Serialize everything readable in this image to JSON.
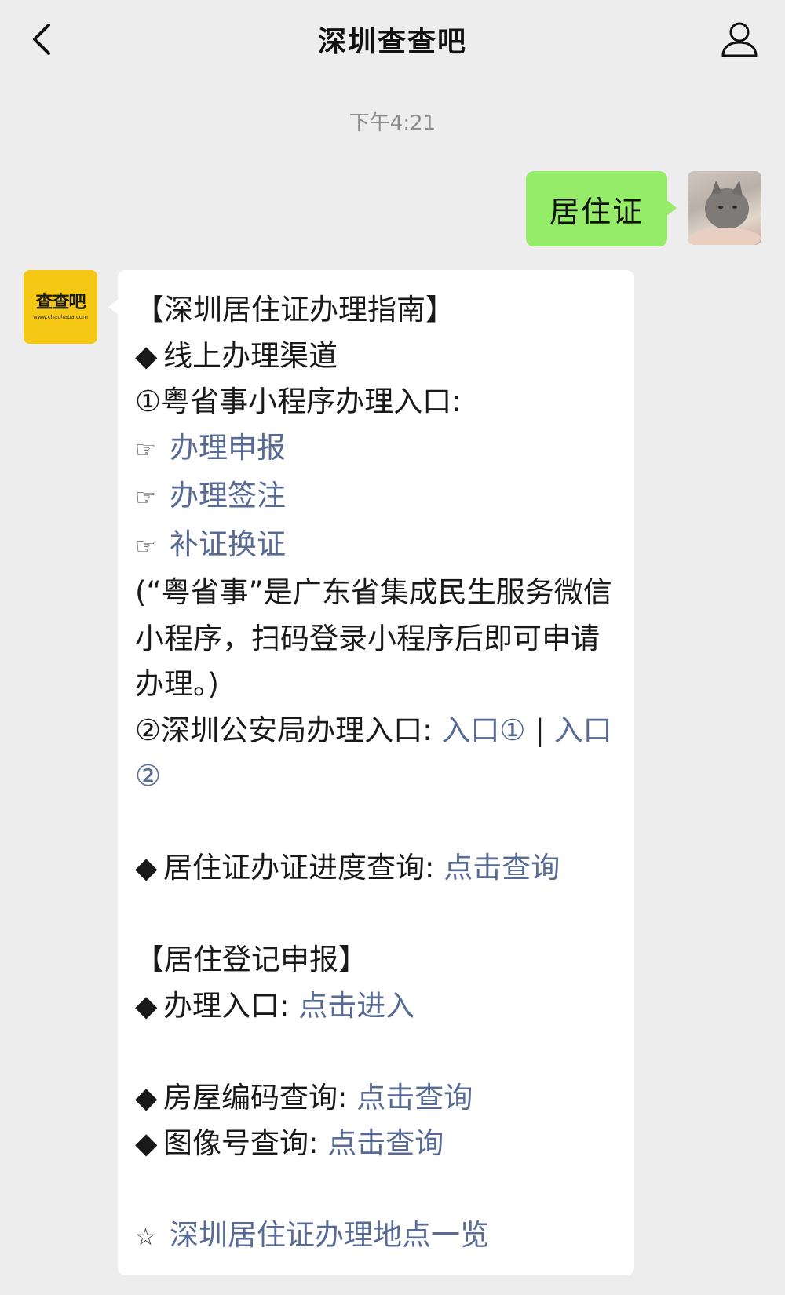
{
  "header": {
    "title": "深圳查查吧"
  },
  "timestamp": "下午4:21",
  "sent": {
    "text": "居住证"
  },
  "bot": {
    "logo_text": "查查吧",
    "logo_url": "www.chachaba.com"
  },
  "message": {
    "heading": "【深圳居住证办理指南】",
    "online_title": "线上办理渠道",
    "entry1": "①粤省事小程序办理入口:",
    "links": [
      "办理申报",
      "办理签注",
      "补证换证"
    ],
    "note": "(“粤省事”是广东省集成民生服务微信小程序，扫码登录小程序后即可申请办理。)",
    "entry2_prefix": "②深圳公安局办理入口: ",
    "entry2_link1": "入口①",
    "entry2_sep": " | ",
    "entry2_link2": "入口②",
    "progress_label": "居住证办证进度查询: ",
    "progress_link": "点击查询",
    "reg_heading": "【居住登记申报】",
    "reg_label": "办理入口: ",
    "reg_link": "点击进入",
    "house_label": "房屋编码查询: ",
    "house_link": "点击查询",
    "image_label": "图像号查询: ",
    "image_link": "点击查询",
    "places_link": "深圳居住证办理地点一览"
  }
}
